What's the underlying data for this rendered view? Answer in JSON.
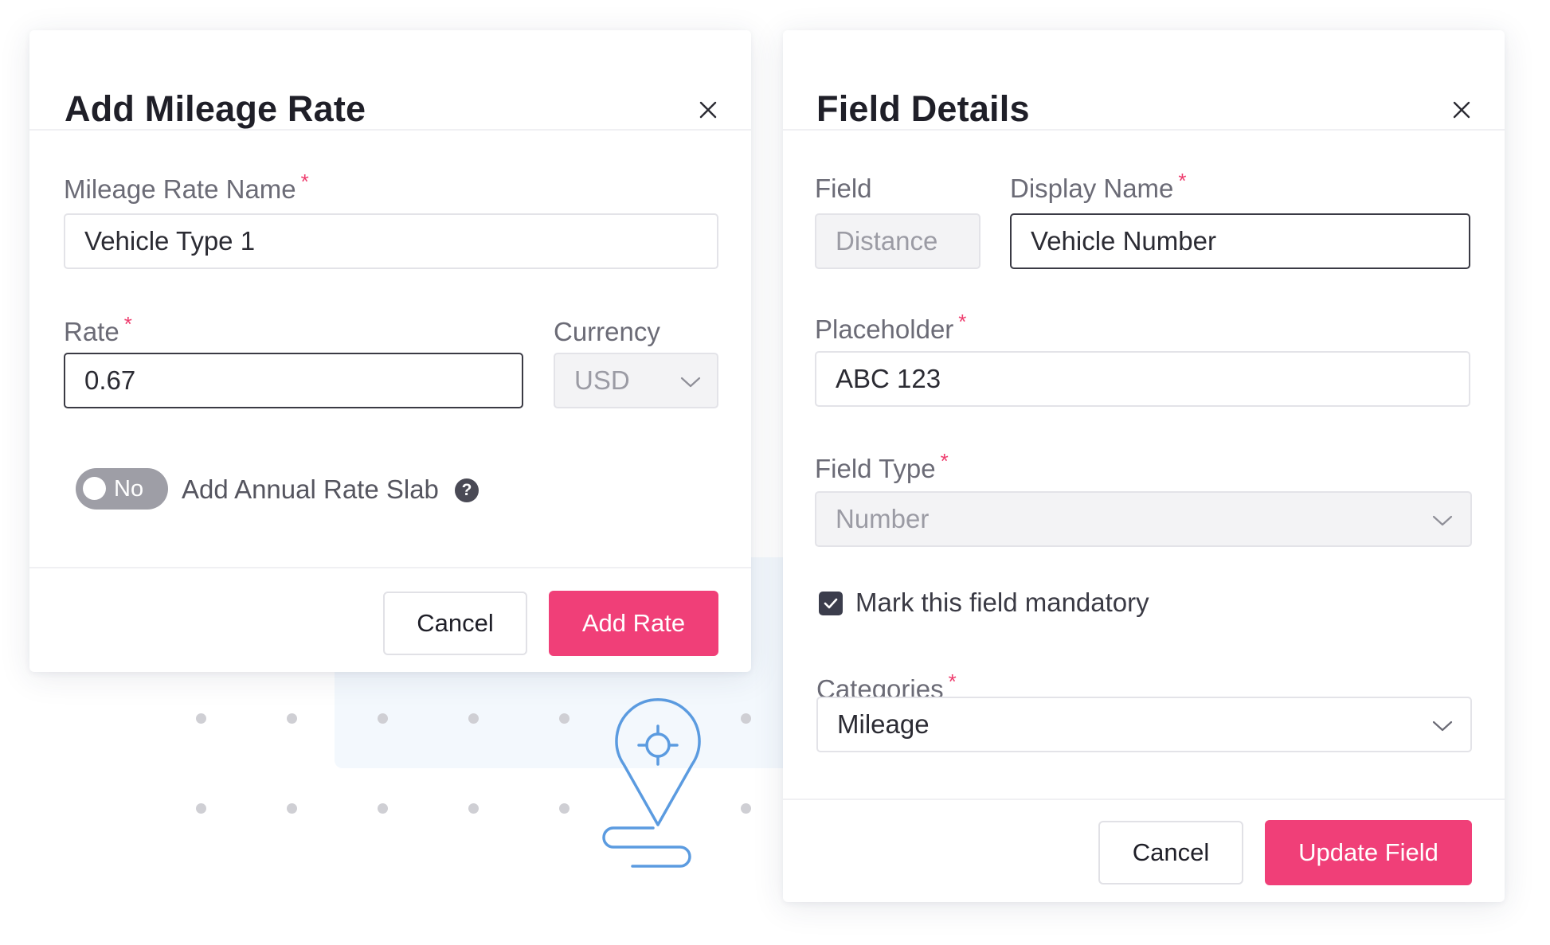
{
  "mileage_modal": {
    "title": "Add Mileage Rate",
    "name_label": "Mileage Rate Name",
    "name_value": "Vehicle Type 1",
    "rate_label": "Rate",
    "rate_value": "0.67",
    "currency_label": "Currency",
    "currency_value": "USD",
    "toggle_state": "No",
    "toggle_label": "Add Annual Rate Slab",
    "help_glyph": "?",
    "cancel_label": "Cancel",
    "submit_label": "Add Rate",
    "required_mark": "*"
  },
  "field_modal": {
    "title": "Field Details",
    "field_label": "Field",
    "field_value": "Distance",
    "display_name_label": "Display Name",
    "display_name_value": "Vehicle Number",
    "placeholder_label": "Placeholder",
    "placeholder_value": "ABC 123",
    "field_type_label": "Field Type",
    "field_type_value": "Number",
    "mandatory_label": "Mark this field mandatory",
    "mandatory_checked": true,
    "categories_label": "Categories",
    "categories_value": "Mileage",
    "cancel_label": "Cancel",
    "submit_label": "Update Field",
    "required_mark": "*"
  },
  "colors": {
    "primary": "#f03f78",
    "required": "#ee3d6e",
    "toggle_off": "#9e9ea6",
    "checkbox": "#3b3d4c",
    "illustration": "#5b9be0"
  },
  "icons": {
    "close": "close-icon",
    "chevron": "chevron-down-icon",
    "help": "help-icon",
    "check": "check-icon",
    "location": "location-pin-icon"
  }
}
